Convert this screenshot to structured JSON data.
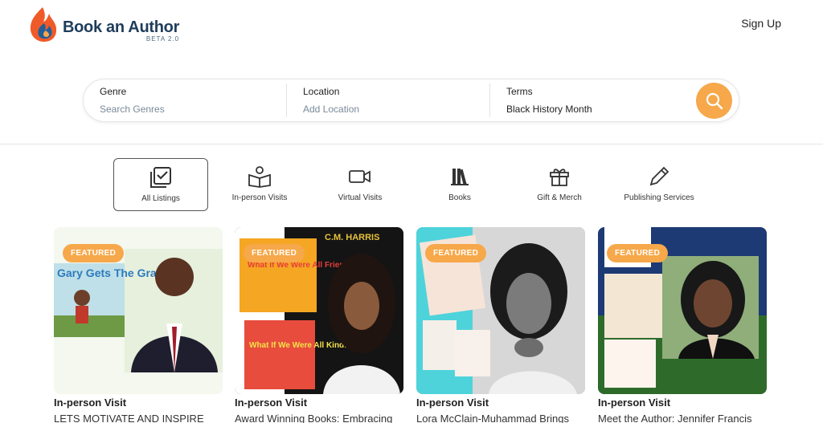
{
  "header": {
    "brand": "Book an Author",
    "version": "BETA 2.0",
    "signup": "Sign Up"
  },
  "search": {
    "genre_label": "Genre",
    "genre_placeholder": "Search Genres",
    "location_label": "Location",
    "location_placeholder": "Add Location",
    "terms_label": "Terms",
    "terms_value": "Black History Month"
  },
  "categories": [
    {
      "label": "All Listings",
      "icon": "checklist-icon",
      "active": true
    },
    {
      "label": "In-person Visits",
      "icon": "open-book-person-icon",
      "active": false
    },
    {
      "label": "Virtual Visits",
      "icon": "video-camera-icon",
      "active": false
    },
    {
      "label": "Books",
      "icon": "books-icon",
      "active": false
    },
    {
      "label": "Gift & Merch",
      "icon": "gift-icon",
      "active": false
    },
    {
      "label": "Publishing Services",
      "icon": "pencil-icon",
      "active": false
    }
  ],
  "cards": [
    {
      "badge": "FEATURED",
      "type": "In-person Visit",
      "title": "LETS MOTIVATE AND INSPIRE",
      "book_title": "Gary Gets The Grade"
    },
    {
      "badge": "FEATURED",
      "type": "In-person Visit",
      "title": "Award Winning Books: Embracing",
      "banner": "C.M. HARRIS",
      "book_title": "What If We Were All Friends!",
      "book_title_2": "What If We Were All Kind!"
    },
    {
      "badge": "FEATURED",
      "type": "In-person Visit",
      "title": "Lora McClain-Muhammad Brings"
    },
    {
      "badge": "FEATURED",
      "type": "In-person Visit",
      "title": "Meet the Author: Jennifer Francis"
    }
  ],
  "colors": {
    "accent": "#f6a84a",
    "brand_dark": "#1f3c5a"
  }
}
